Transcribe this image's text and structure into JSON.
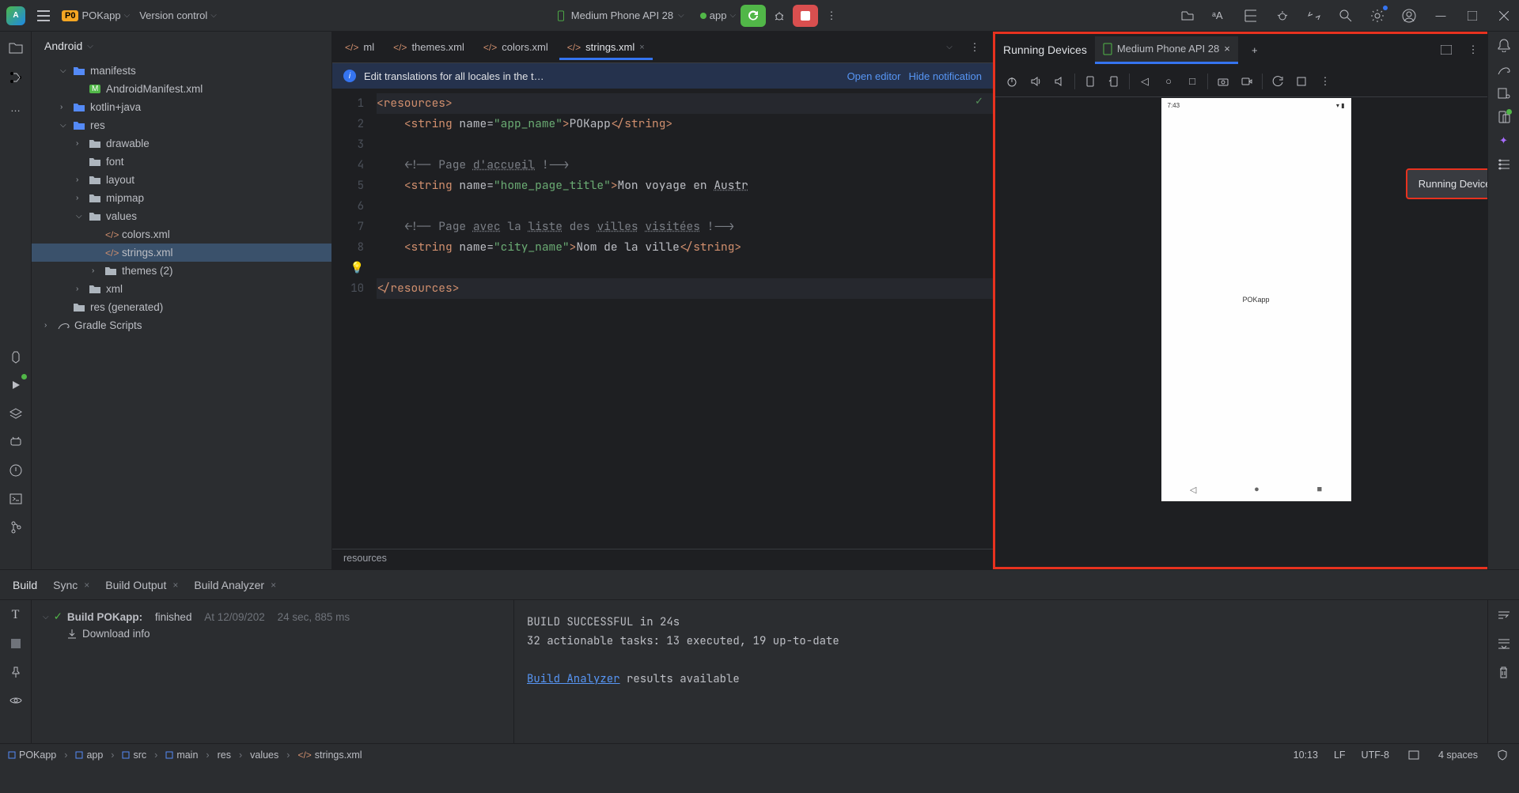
{
  "topbar": {
    "project_badge": "P0",
    "project_name": "POKapp",
    "vcs": "Version control",
    "device": "Medium Phone API 28",
    "run_config": "app"
  },
  "project": {
    "panel_title": "Android",
    "tree": [
      {
        "label": "manifests",
        "indent": 1,
        "expanded": true,
        "icon": "folder-blue"
      },
      {
        "label": "AndroidManifest.xml",
        "indent": 2,
        "icon": "manifest"
      },
      {
        "label": "kotlin+java",
        "indent": 1,
        "expanded": false,
        "icon": "folder-blue"
      },
      {
        "label": "res",
        "indent": 1,
        "expanded": true,
        "icon": "folder-blue"
      },
      {
        "label": "drawable",
        "indent": 2,
        "expanded": false,
        "icon": "folder"
      },
      {
        "label": "font",
        "indent": 2,
        "icon": "folder"
      },
      {
        "label": "layout",
        "indent": 2,
        "expanded": false,
        "icon": "folder"
      },
      {
        "label": "mipmap",
        "indent": 2,
        "expanded": false,
        "icon": "folder"
      },
      {
        "label": "values",
        "indent": 2,
        "expanded": true,
        "icon": "folder"
      },
      {
        "label": "colors.xml",
        "indent": 3,
        "icon": "xml"
      },
      {
        "label": "strings.xml",
        "indent": 3,
        "icon": "xml",
        "selected": true
      },
      {
        "label": "themes (2)",
        "indent": 3,
        "expanded": false,
        "icon": "folder"
      },
      {
        "label": "xml",
        "indent": 2,
        "expanded": false,
        "icon": "folder"
      },
      {
        "label": "res (generated)",
        "indent": 1,
        "icon": "folder-gen"
      },
      {
        "label": "Gradle Scripts",
        "indent": 0,
        "expanded": false,
        "icon": "gradle"
      }
    ]
  },
  "editor": {
    "tabs": [
      {
        "label": "ml",
        "icon": "xml"
      },
      {
        "label": "themes.xml",
        "icon": "xml"
      },
      {
        "label": "colors.xml",
        "icon": "xml"
      },
      {
        "label": "strings.xml",
        "icon": "xml",
        "active": true,
        "closable": true
      }
    ],
    "notification": {
      "text": "Edit translations for all locales in the t…",
      "open": "Open editor",
      "hide": "Hide notification"
    },
    "breadcrumb": "resources",
    "lines": [
      {
        "num": 1,
        "h": "<span class='kw'>&lt;resources&gt;</span>",
        "hl": true
      },
      {
        "num": 2,
        "h": "    <span class='kw'>&lt;string</span> <span class='attr'>name=</span><span class='str'>\"app_name\"</span><span class='kw'>&gt;</span><span class='txt'>POKapp</span><span class='kw'>&lt;/string&gt;</span>"
      },
      {
        "num": 3,
        "h": ""
      },
      {
        "num": 4,
        "h": "    <span class='comment'>&lt;!-- Page <span class='underline'>d'accueil</span> !--&gt;</span>"
      },
      {
        "num": 5,
        "h": "    <span class='kw'>&lt;string</span> <span class='attr'>name=</span><span class='str'>\"home_page_title\"</span><span class='kw'>&gt;</span><span class='txt'>Mon voyage en <span class='underline'>Austr</span></span>"
      },
      {
        "num": 6,
        "h": ""
      },
      {
        "num": 7,
        "h": "    <span class='comment'>&lt;!-- Page <span class='underline'>avec</span> la <span class='underline'>liste</span> des <span class='underline'>villes</span> <span class='underline'>visitées</span> !--&gt;</span>"
      },
      {
        "num": 8,
        "h": "    <span class='kw'>&lt;string</span> <span class='attr'>name=</span><span class='str'>\"city_name\"</span><span class='kw'>&gt;</span><span class='txt'>Nom de la ville</span><span class='kw'>&lt;/string&gt;</span>"
      },
      {
        "num": 9,
        "h": "",
        "bulb": true
      },
      {
        "num": 10,
        "h": "<span class='kw'>&lt;/resources&gt;</span>",
        "hl": true
      }
    ]
  },
  "devices": {
    "title": "Running Devices",
    "tab": "Medium Phone API 28",
    "tooltip": "Running Devices",
    "phone": {
      "time": "7:43",
      "app": "POKapp"
    }
  },
  "bottom": {
    "tabs": {
      "build": "Build",
      "sync": "Sync",
      "output": "Build Output",
      "analyzer": "Build Analyzer"
    },
    "row": {
      "title": "Build POKapp:",
      "status": "finished",
      "at": "At 12/09/202",
      "dur": "24 sec, 885 ms"
    },
    "download": "Download info",
    "out1": "BUILD SUCCESSFUL in 24s",
    "out2": "32 actionable tasks: 13 executed, 19 up-to-date",
    "out3_link": "Build Analyzer",
    "out3_rest": " results available"
  },
  "footer": {
    "crumbs": [
      "POKapp",
      "app",
      "src",
      "main",
      "res",
      "values",
      "strings.xml"
    ],
    "pos": "10:13",
    "sep": "LF",
    "enc": "UTF-8",
    "indent": "4 spaces"
  }
}
